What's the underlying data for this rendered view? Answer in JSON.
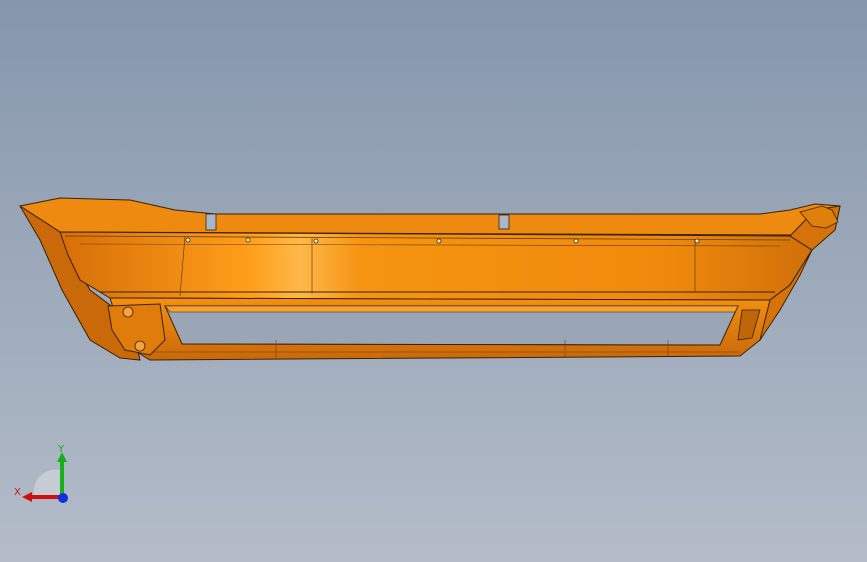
{
  "viewport": {
    "background_top": "#8696ab",
    "background_bottom": "#b4bcc9"
  },
  "model": {
    "part_color": "#f08a0c",
    "edge_color": "#3a2205",
    "icon": "bumper-part"
  },
  "triad": {
    "x_label": "X",
    "y_label": "Y",
    "x_color": "#d01010",
    "y_color": "#18b018",
    "z_color": "#1030e0"
  }
}
